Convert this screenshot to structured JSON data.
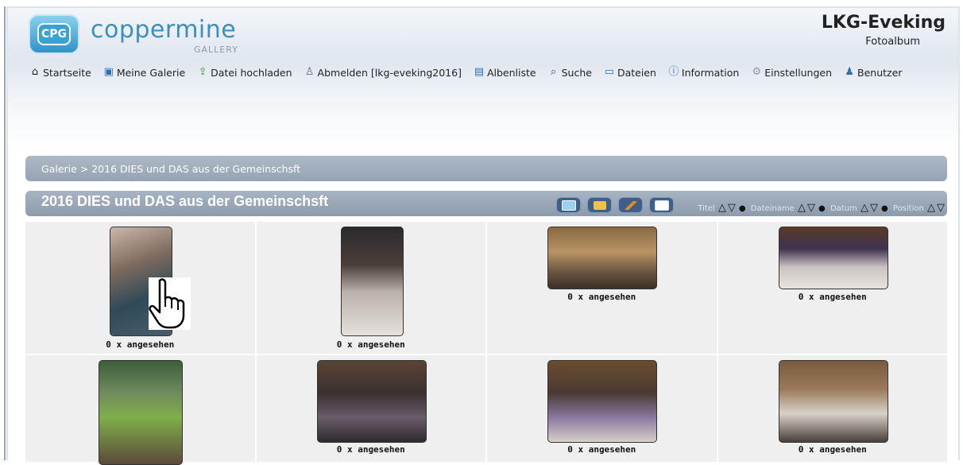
{
  "header": {
    "logo_badge": "CPG",
    "logo_word": "coppermine",
    "logo_sub": "GALLERY",
    "site_title": "LKG-Eveking",
    "site_subtitle": "Fotoalbum"
  },
  "nav": [
    {
      "label": "Startseite",
      "icon": "home-icon"
    },
    {
      "label": "Meine Galerie",
      "icon": "my-gallery-icon"
    },
    {
      "label": "Datei hochladen",
      "icon": "upload-icon"
    },
    {
      "label": "Abmelden [lkg-eveking2016]",
      "icon": "logout-icon"
    },
    {
      "label": "Albenliste",
      "icon": "album-list-icon"
    },
    {
      "label": "Suche",
      "icon": "search-icon"
    },
    {
      "label": "Dateien",
      "icon": "files-icon"
    },
    {
      "label": "Information",
      "icon": "info-icon"
    },
    {
      "label": "Einstellungen",
      "icon": "settings-icon"
    },
    {
      "label": "Benutzer",
      "icon": "user-icon"
    }
  ],
  "breadcrumb": "Galerie > 2016 DIES und DAS aus der Gemeinschsft",
  "album": {
    "title": "2016 DIES und DAS aus der Gemeinschsft",
    "sort": {
      "title_label": "Titel",
      "filename_label": "Dateiname",
      "date_label": "Datum",
      "position_label": "Position",
      "up": "△",
      "down": "▽",
      "sep": "●"
    }
  },
  "thumbnails": [
    {
      "caption": "0 x angesehen"
    },
    {
      "caption": "0 x angesehen"
    },
    {
      "caption": "0 x angesehen"
    },
    {
      "caption": "0 x angesehen"
    },
    {
      "caption": ""
    },
    {
      "caption": "0 x angesehen"
    },
    {
      "caption": "0 x angesehen"
    },
    {
      "caption": "0 x angesehen"
    }
  ],
  "colors": {
    "accent": "#3b8fc0",
    "bar": "#95a3b3",
    "view_button": "#3f5f86"
  }
}
